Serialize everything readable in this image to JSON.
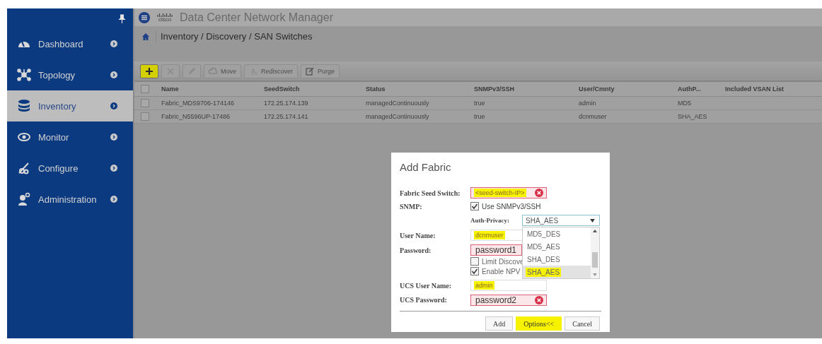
{
  "header": {
    "logo": "cisco",
    "title": "Data Center Network Manager"
  },
  "sidebar": {
    "items": [
      {
        "label": "Dashboard",
        "selected": false
      },
      {
        "label": "Topology",
        "selected": false
      },
      {
        "label": "Inventory",
        "selected": true
      },
      {
        "label": "Monitor",
        "selected": false
      },
      {
        "label": "Configure",
        "selected": false
      },
      {
        "label": "Administration",
        "selected": false
      }
    ]
  },
  "breadcrumb": "Inventory / Discovery / SAN Switches",
  "toolbar": [
    {
      "kind": "add",
      "disabled": false,
      "highlighted": true
    },
    {
      "kind": "delete",
      "disabled": true,
      "highlighted": false
    },
    {
      "kind": "edit",
      "disabled": true,
      "highlighted": false
    },
    {
      "kind": "move",
      "label": "Move",
      "disabled": true,
      "highlighted": false
    },
    {
      "kind": "rediscover",
      "label": "Rediscover",
      "disabled": true,
      "highlighted": false
    },
    {
      "kind": "purge",
      "label": "Purge",
      "disabled": true,
      "highlighted": false
    }
  ],
  "table": {
    "all_checked": false,
    "columns": [
      "Name",
      "SeedSwitch",
      "Status",
      "SNMPv3/SSH",
      "User/Cmnty",
      "AuthP...",
      "Included VSAN List"
    ],
    "rows": [
      {
        "checked": false,
        "cells": [
          "Fabric_MDS9706-174146",
          "172.25.174.139",
          "managedContinuously",
          "true",
          "admin",
          "MD5",
          ""
        ]
      },
      {
        "checked": false,
        "cells": [
          "Fabric_N5596UP-17486",
          "172.25.174.141",
          "managedContinuously",
          "true",
          "dcnmuser",
          "SHA_AES",
          ""
        ]
      }
    ]
  },
  "dialog": {
    "title": "Add Fabric",
    "seed_switch": {
      "label": "Fabric Seed Switch:",
      "value": "<seed-switch-IP>",
      "highlighted": true,
      "invalid": true,
      "error_icon": true
    },
    "snmp": {
      "label": "SNMP:",
      "option": "Use SNMPv3/SSH",
      "checked": true
    },
    "auth_privacy": {
      "label": "Auth-Privacy:",
      "value": "SHA_AES",
      "expanded": true,
      "options": [
        {
          "label": "MD5_DES",
          "selected": false,
          "highlighted": false
        },
        {
          "label": "MD5_AES",
          "selected": false,
          "highlighted": false
        },
        {
          "label": "SHA_DES",
          "selected": false,
          "highlighted": false
        },
        {
          "label": "SHA_AES",
          "selected": true,
          "highlighted": true
        }
      ]
    },
    "user_name": {
      "label": "User Name:",
      "value": "dcnmuser",
      "highlighted": true,
      "invalid": false
    },
    "password": {
      "label": "Password:",
      "value": "password1",
      "highlighted": false,
      "invalid": true,
      "error_icon": false
    },
    "limit_discovery": {
      "option": "Limit Discove",
      "checked": false
    },
    "enable_npv": {
      "option": "Enable NPV",
      "checked": true
    },
    "ucs_user_name": {
      "label": "UCS User Name:",
      "value": "admin",
      "highlighted": true,
      "invalid": false,
      "error_icon": false
    },
    "ucs_password": {
      "label": "UCS Password:",
      "value": "password2",
      "highlighted": false,
      "invalid": true,
      "error_icon": true
    },
    "buttons": [
      {
        "label": "Add",
        "highlighted": false
      },
      {
        "label": "Options<<",
        "highlighted": true
      },
      {
        "label": "Cancel",
        "highlighted": false
      }
    ]
  }
}
